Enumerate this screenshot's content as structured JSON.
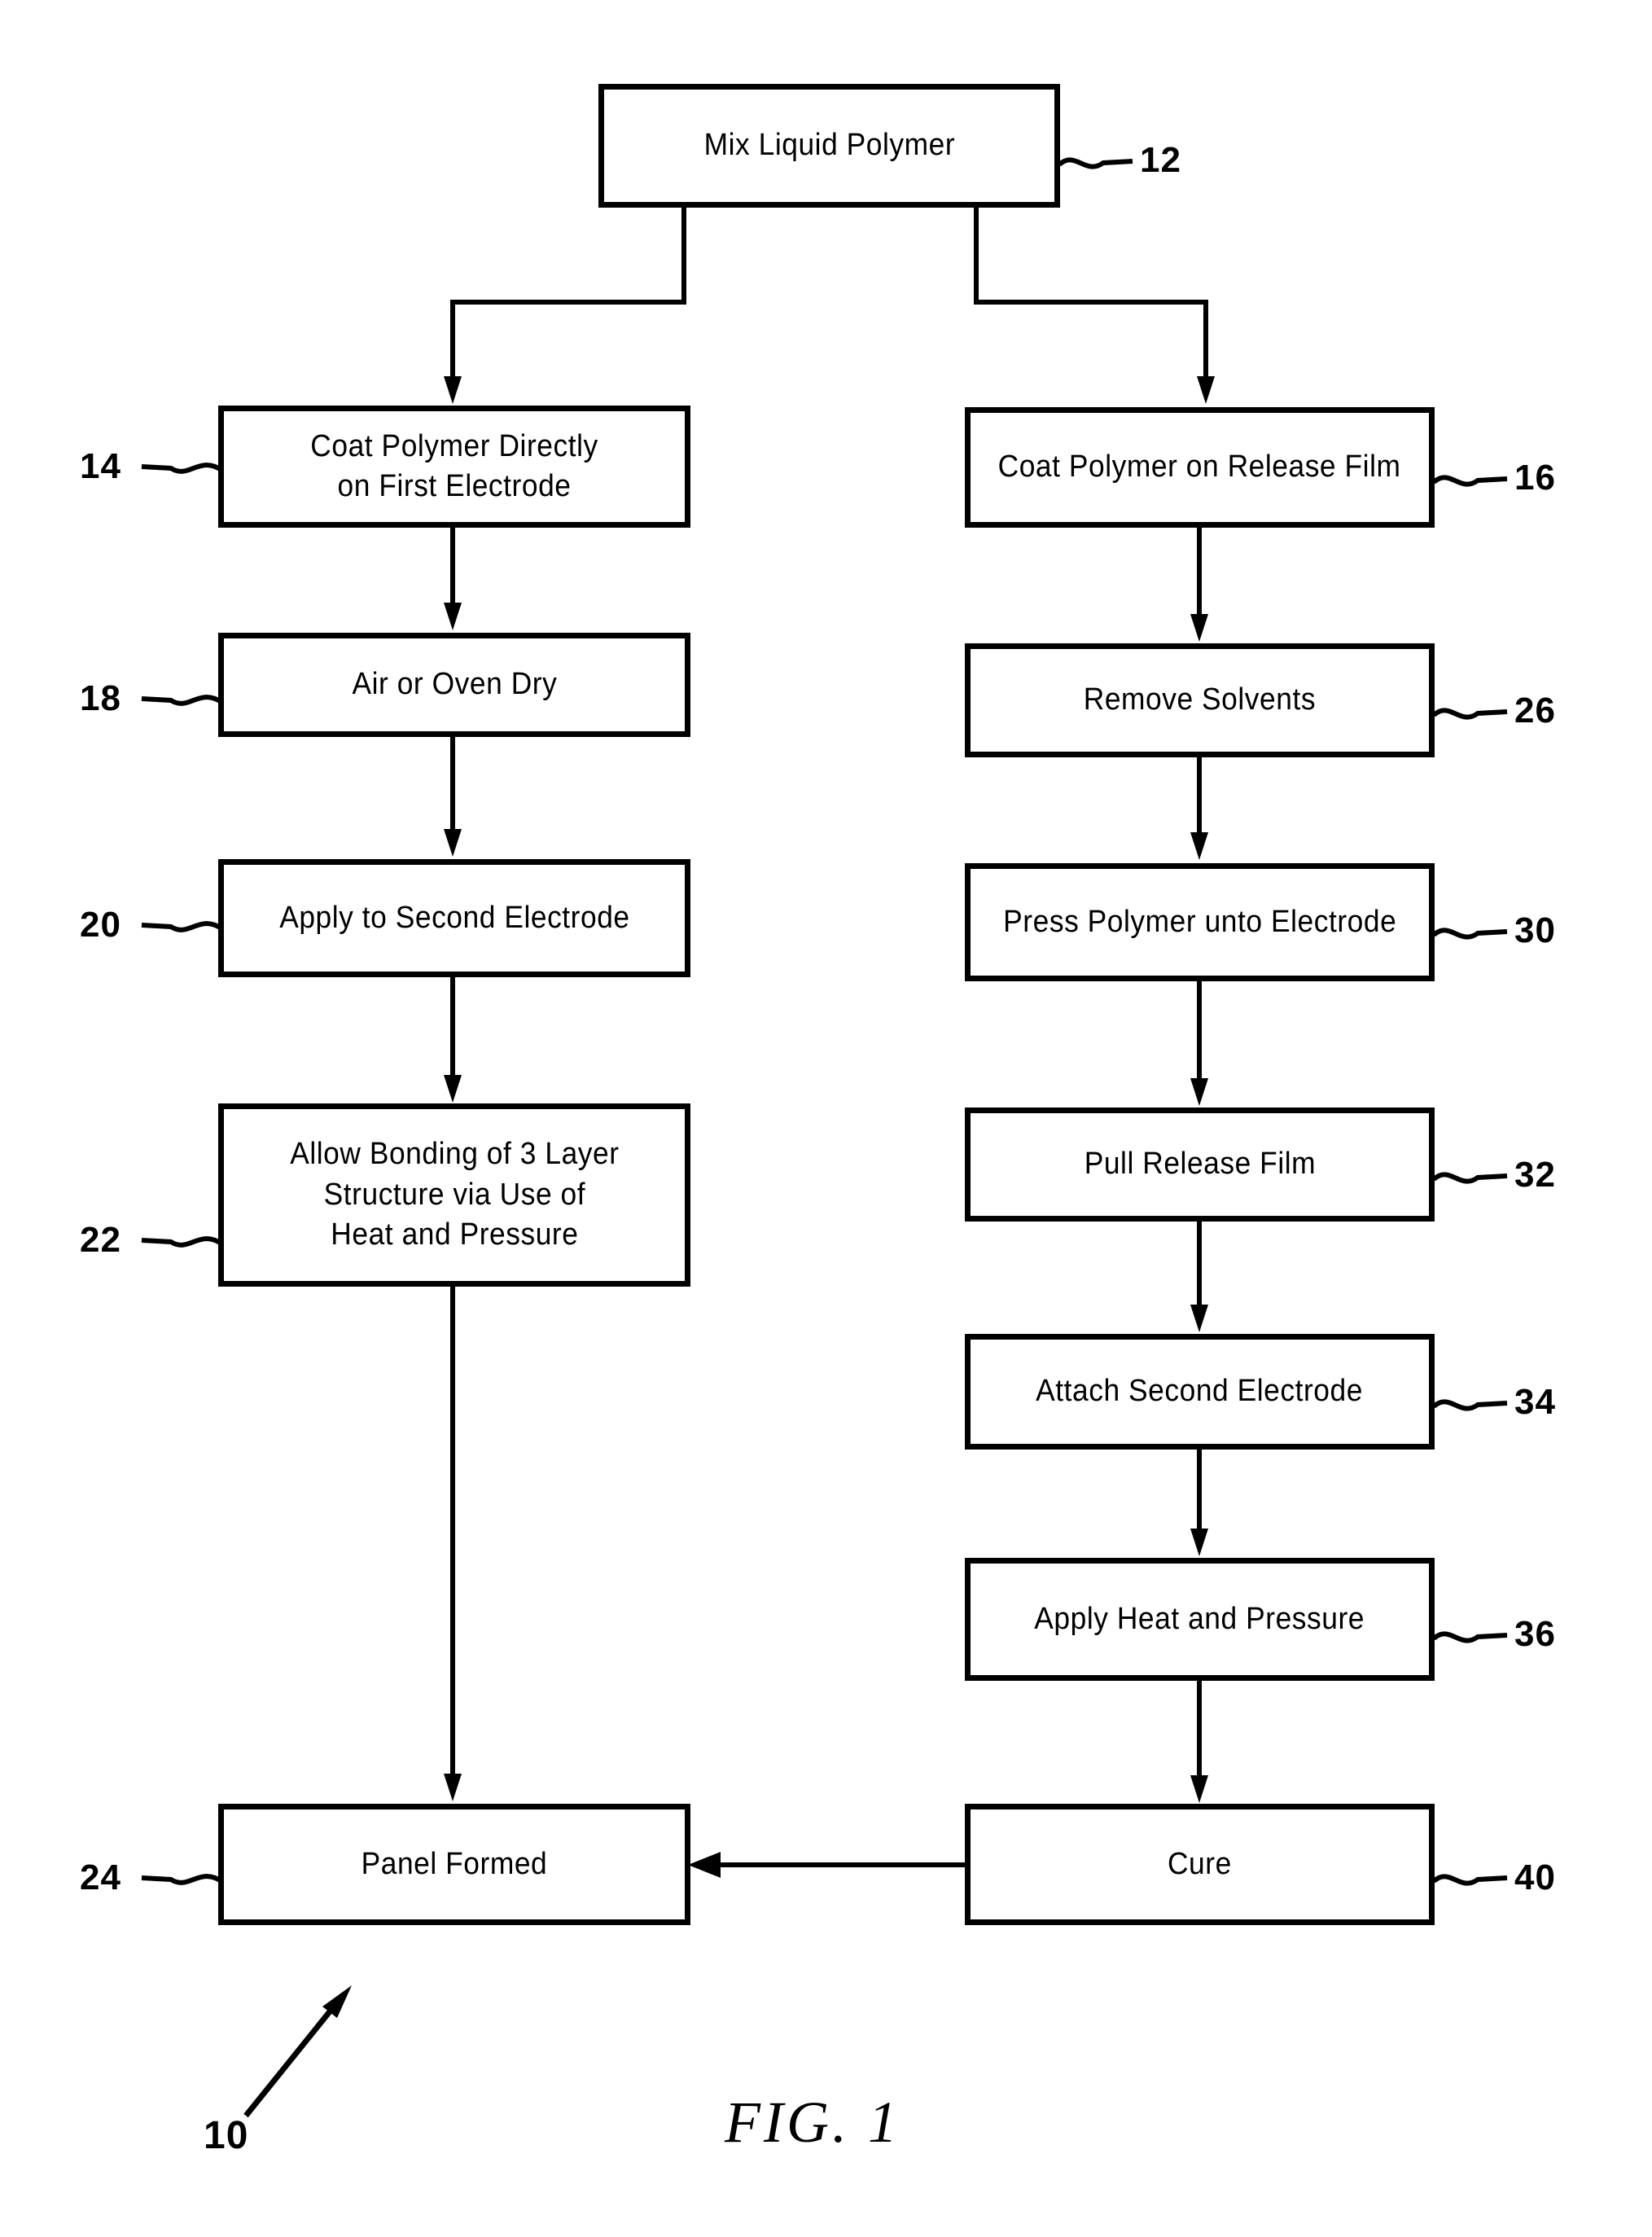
{
  "figure": {
    "caption": "FIG. 1",
    "assembly_numeral": "10"
  },
  "nodes": {
    "mix": {
      "label": "Mix Liquid Polymer",
      "ref": "12"
    },
    "coat_direct": {
      "label": "Coat Polymer Directly\non First Electrode",
      "ref": "14"
    },
    "coat_film": {
      "label": "Coat Polymer on Release Film",
      "ref": "16"
    },
    "dry": {
      "label": "Air or Oven Dry",
      "ref": "18"
    },
    "apply2nd": {
      "label": "Apply to Second Electrode",
      "ref": "20"
    },
    "bond": {
      "label": "Allow Bonding of 3 Layer\nStructure via Use of\nHeat and Pressure",
      "ref": "22"
    },
    "panel": {
      "label": "Panel Formed",
      "ref": "24"
    },
    "solvents": {
      "label": "Remove Solvents",
      "ref": "26"
    },
    "press": {
      "label": "Press Polymer unto Electrode",
      "ref": "30"
    },
    "pull": {
      "label": "Pull Release Film",
      "ref": "32"
    },
    "attach": {
      "label": "Attach Second Electrode",
      "ref": "34"
    },
    "heatpress": {
      "label": "Apply Heat and Pressure",
      "ref": "36"
    },
    "cure": {
      "label": "Cure",
      "ref": "40"
    }
  },
  "colors": {
    "ink": "#000000",
    "paper": "#ffffff"
  }
}
